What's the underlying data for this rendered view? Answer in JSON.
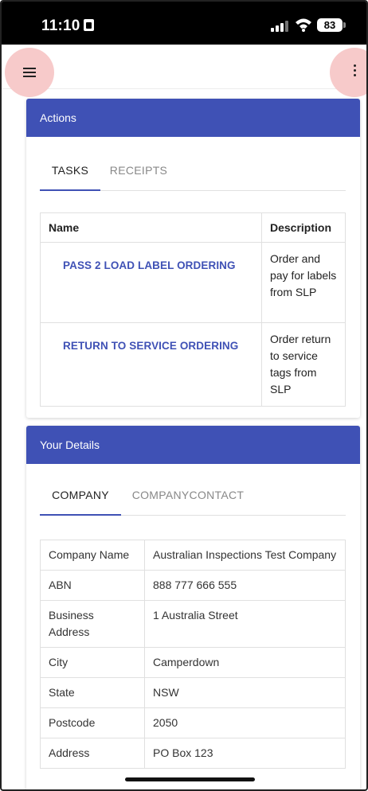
{
  "status_bar": {
    "time": "11:10",
    "battery": "83"
  },
  "actions": {
    "title": "Actions",
    "tabs": [
      {
        "label": "TASKS"
      },
      {
        "label": "RECEIPTS"
      }
    ],
    "columns": {
      "name": "Name",
      "description": "Description"
    },
    "rows": [
      {
        "name": "PASS 2 LOAD LABEL ORDERING",
        "description": "Order and pay for labels from SLP"
      },
      {
        "name": "RETURN TO SERVICE ORDERING",
        "description": "Order return to service tags from SLP"
      }
    ]
  },
  "details": {
    "title": "Your Details",
    "tabs": [
      {
        "label": "COMPANY"
      },
      {
        "label": "COMPANYCONTACT"
      }
    ],
    "rows": [
      {
        "label": "Company Name",
        "value": "Australian Inspections Test Company"
      },
      {
        "label": "ABN",
        "value": "888 777 666 555"
      },
      {
        "label": "Business Address",
        "value": "1 Australia Street"
      },
      {
        "label": "City",
        "value": "Camperdown"
      },
      {
        "label": "State",
        "value": "NSW"
      },
      {
        "label": "Postcode",
        "value": "2050"
      },
      {
        "label": "Address",
        "value": "PO Box 123"
      }
    ]
  },
  "colors": {
    "primary": "#3f51b5",
    "highlight": "#f7caca"
  }
}
